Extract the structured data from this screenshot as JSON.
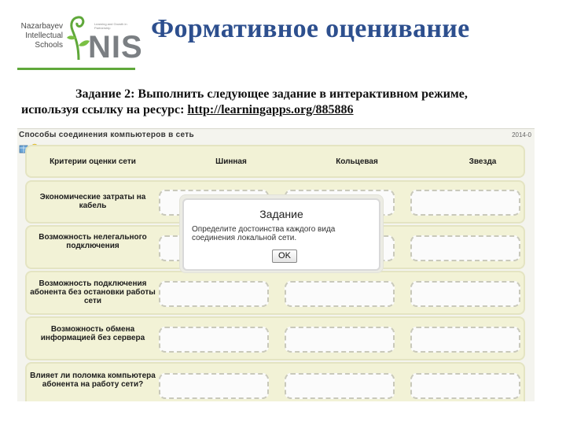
{
  "logo": {
    "lines": [
      "Nazarbayev",
      "Intellectual",
      "Schools"
    ],
    "abbr": "NIS",
    "tagline": "Learning and Growth in Partnership",
    "accent": "#5fa83a"
  },
  "slide": {
    "title": "Формативное оценивание",
    "task_line1": "Задание 2: Выполнить следующее задание в интерактивном режиме,",
    "task_line2_prefix": "используя ссылку на ресурс: ",
    "task_link": "http://learningapps.org/885886"
  },
  "app": {
    "title": "Способы соединения компьютеров в сеть",
    "year": "2014-0",
    "header_label": "Критерии оценки сети",
    "columns": [
      "Шинная",
      "Кольцевая",
      "Звезда"
    ],
    "rows": [
      "Экономические затраты на кабель",
      "Возможность нелегального подключения",
      "Возможность подключения абонента без остановки работы сети",
      "Возможность обмена информацией без сервера",
      "Влияет ли поломка компьютера абонента на работу сети?"
    ]
  },
  "dialog": {
    "title": "Задание",
    "text": "Определите достоинства каждого вида соединения локальной сети.",
    "ok_label": "OK"
  }
}
